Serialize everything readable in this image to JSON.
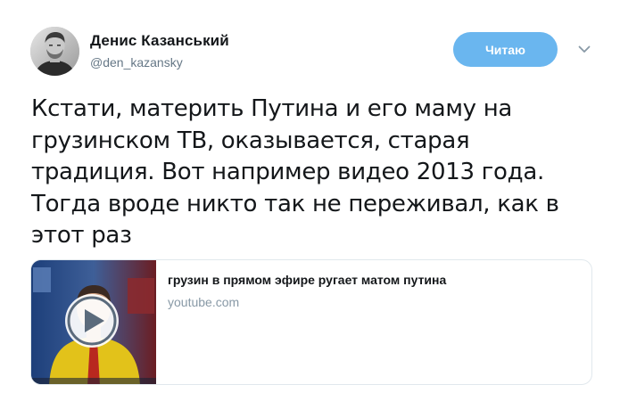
{
  "author": {
    "name": "Денис Казанський",
    "handle": "@den_kazansky"
  },
  "follow_button": {
    "label": "Читаю",
    "color": "#6ab6ef"
  },
  "menu_icon": "chevron-down-icon",
  "tweet": {
    "lines": [
      "Кстати, материть Путина и его маму на",
      "грузинском ТВ, оказывается, старая",
      "традиция. Вот например видео 2013 года.",
      "Тогда вроде никто так не переживал, как в",
      "этот раз"
    ]
  },
  "card": {
    "title": "грузин в прямом эфире ругает матом путина",
    "domain": "youtube.com",
    "thumbnail_icon": "play-icon"
  }
}
